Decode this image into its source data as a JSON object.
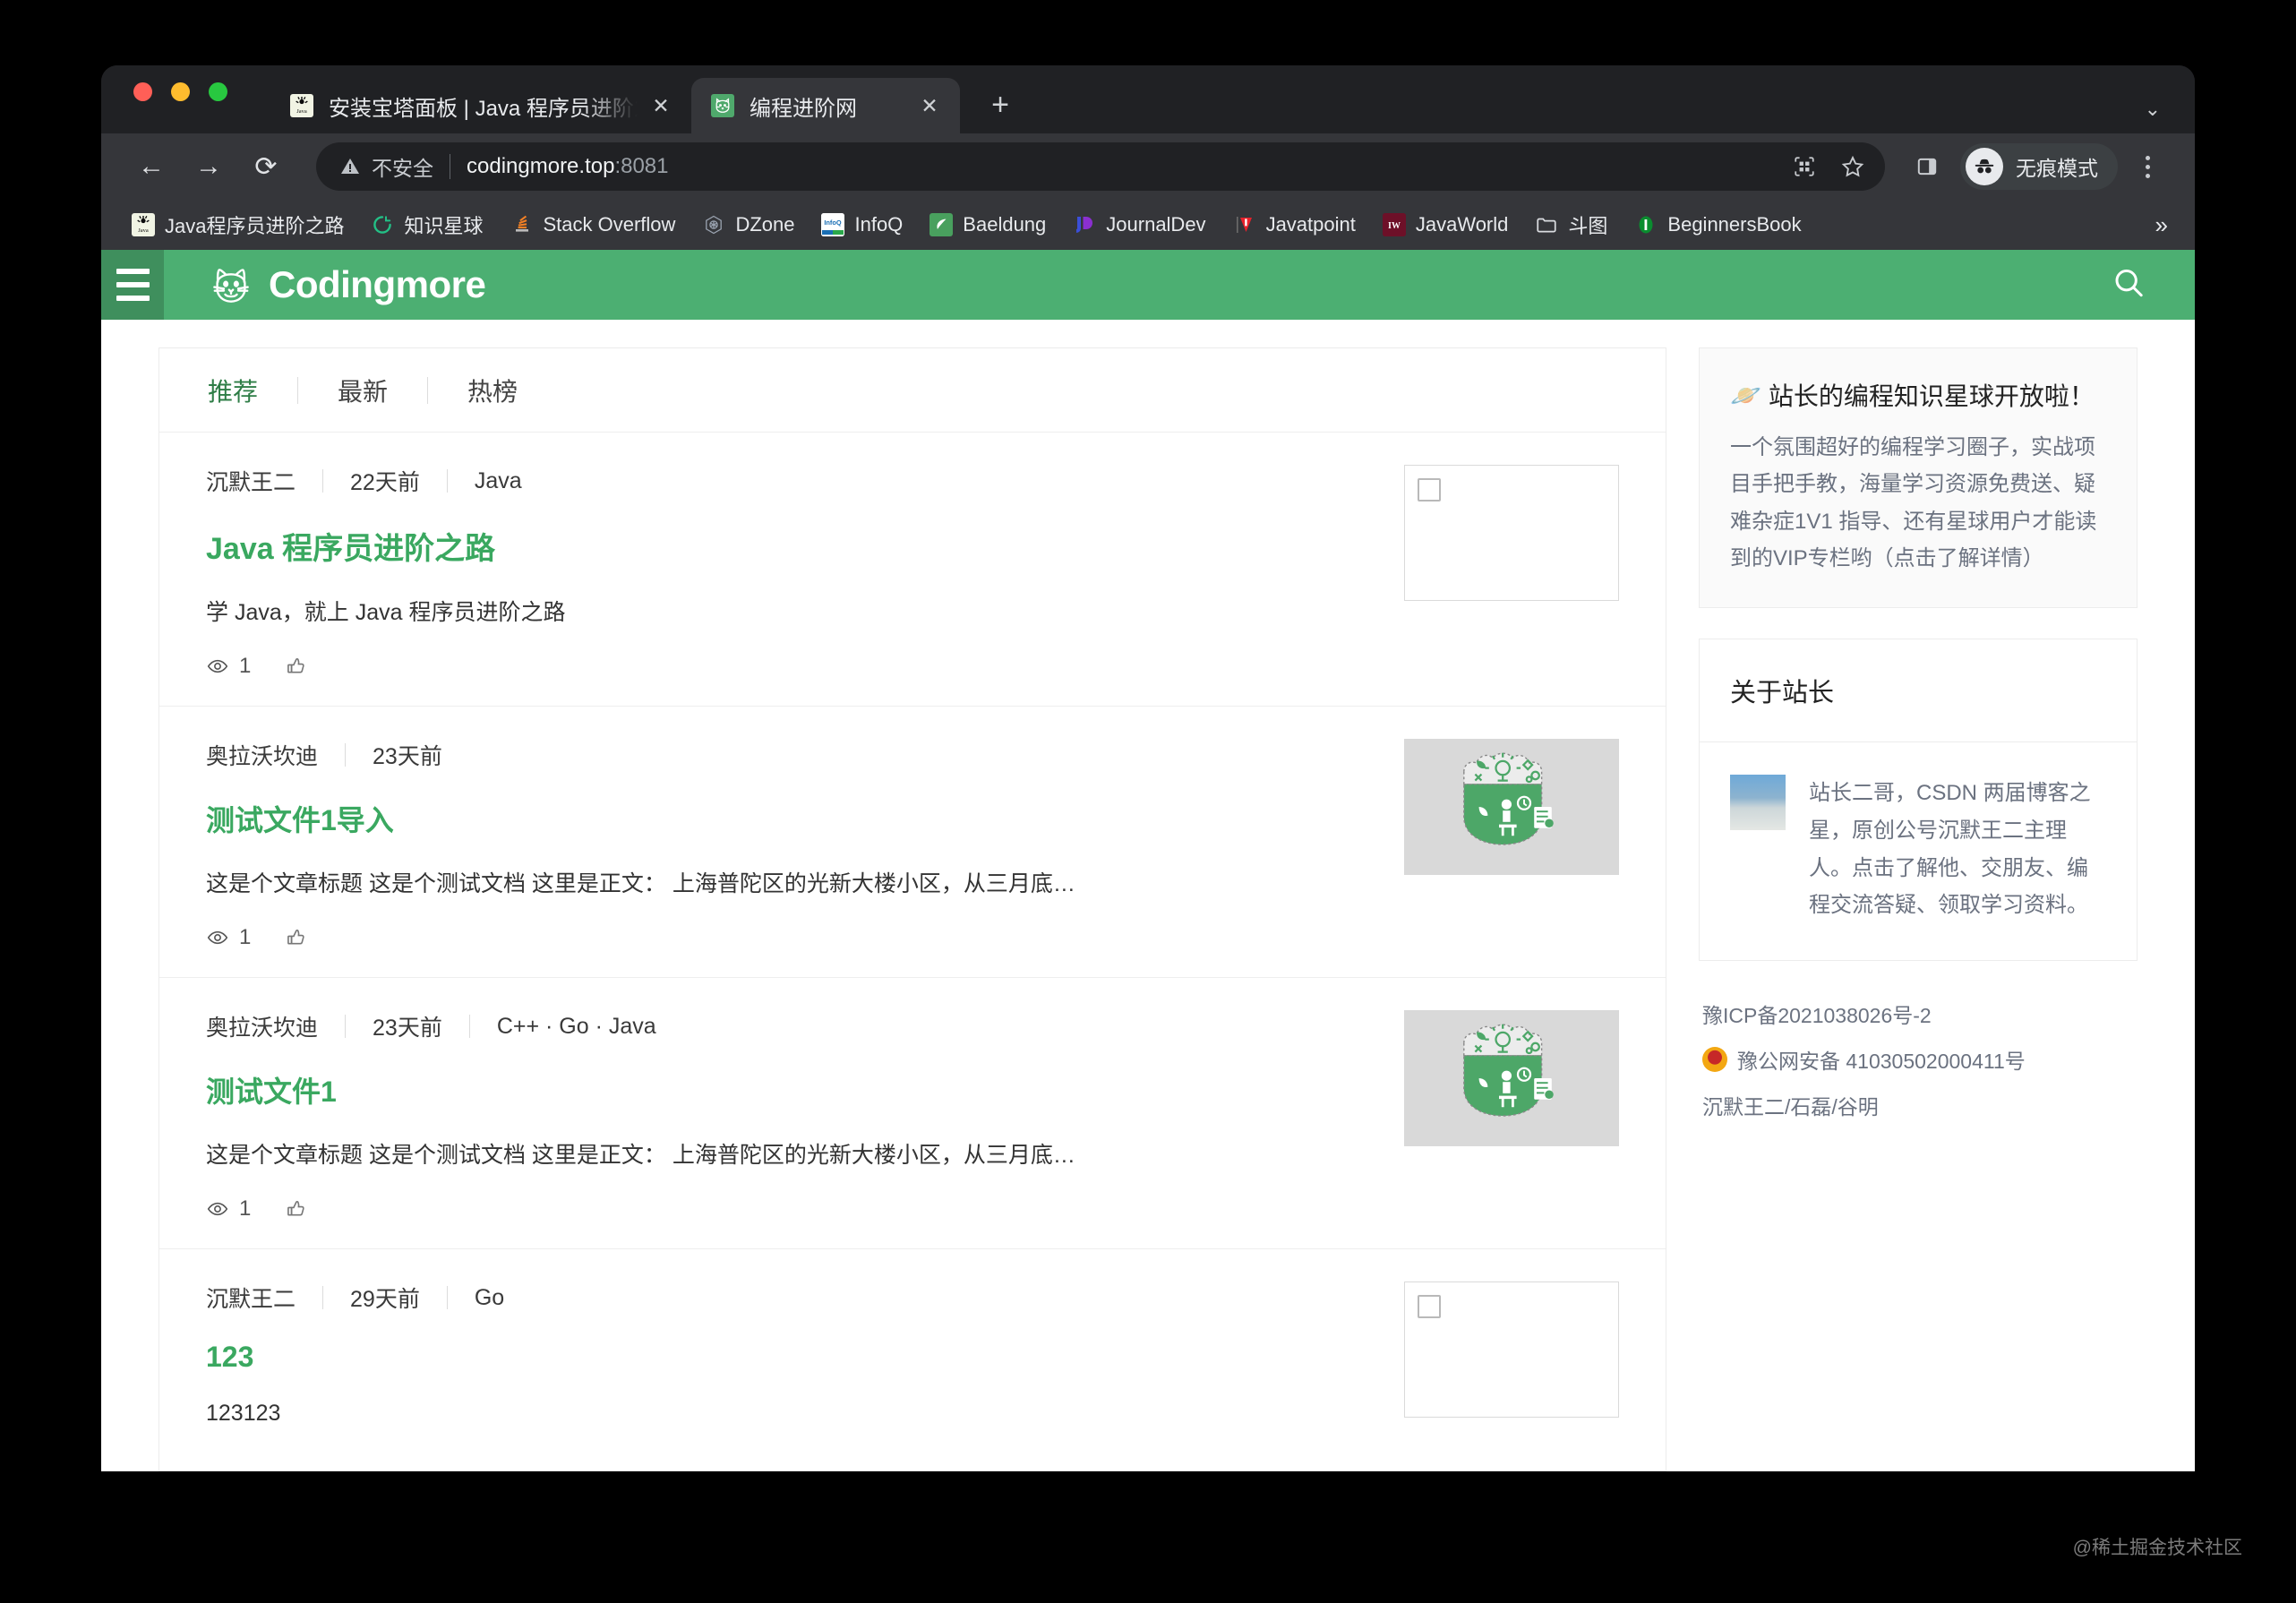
{
  "browser": {
    "tabs": [
      {
        "title": "安装宝塔面板 | Java 程序员进阶之路",
        "favicon": "java-icon",
        "active": false,
        "close_label": "✕"
      },
      {
        "title": "编程进阶网",
        "favicon": "cat-icon",
        "active": true,
        "close_label": "✕"
      }
    ],
    "new_tab_label": "+",
    "tabstrip_expand_label": "⌄",
    "toolbar": {
      "back_label": "←",
      "forward_label": "→",
      "reload_label": "⟳",
      "security_label": "不安全",
      "security_icon": "warning-triangle-icon",
      "url_host": "codingmore.top",
      "url_port": ":8081",
      "qr_icon": "qr-code-icon",
      "bookmark_icon": "star-icon",
      "sidepanel_icon": "side-panel-icon",
      "incognito_label": "无痕模式",
      "incognito_icon": "incognito-icon",
      "menu_icon": "kebab-menu-icon"
    },
    "bookmarks": [
      {
        "label": "Java程序员进阶之路",
        "icon": "java-favicon"
      },
      {
        "label": "知识星球",
        "icon": "zsxq-favicon"
      },
      {
        "label": "Stack Overflow",
        "icon": "stackoverflow-favicon"
      },
      {
        "label": "DZone",
        "icon": "dzone-favicon"
      },
      {
        "label": "InfoQ",
        "icon": "infoq-favicon"
      },
      {
        "label": "Baeldung",
        "icon": "baeldung-favicon"
      },
      {
        "label": "JournalDev",
        "icon": "journaldev-favicon"
      },
      {
        "label": "Javatpoint",
        "icon": "javatpoint-favicon"
      },
      {
        "label": "JavaWorld",
        "icon": "javaworld-favicon"
      },
      {
        "label": "斗图",
        "icon": "folder-icon"
      },
      {
        "label": "BeginnersBook",
        "icon": "beginnersbook-favicon"
      }
    ],
    "bookmarks_overflow_label": "»"
  },
  "site": {
    "brand": "Codingmore",
    "menu_icon": "hamburger-icon",
    "logo_icon": "cat-logo-icon",
    "search_icon": "search-icon",
    "accent_color": "#4caf72",
    "header_dark_color": "#3f8f5d",
    "link_color": "#3aa860"
  },
  "feed": {
    "tabs": [
      {
        "label": "推荐",
        "active": true
      },
      {
        "label": "最新",
        "active": false
      },
      {
        "label": "热榜",
        "active": false
      }
    ],
    "articles": [
      {
        "author": "沉默王二",
        "time": "22天前",
        "tags": "Java",
        "title": "Java 程序员进阶之路",
        "desc": "学 Java，就上 Java 程序员进阶之路",
        "views": "1",
        "view_icon": "eye-icon",
        "like_icon": "thumbs-up-icon",
        "thumb": "broken-image"
      },
      {
        "author": "奥拉沃坎迪",
        "time": "23天前",
        "tags": "",
        "title": "测试文件1导入",
        "desc": "这是个文章标题 这是个测试文档  这里是正文： 上海普陀区的光新大楼小区，从三月底…",
        "views": "1",
        "view_icon": "eye-icon",
        "like_icon": "thumbs-up-icon",
        "thumb": "badge-image"
      },
      {
        "author": "奥拉沃坎迪",
        "time": "23天前",
        "tags": "C++ · Go · Java",
        "title": "测试文件1",
        "desc": "这是个文章标题 这是个测试文档  这里是正文： 上海普陀区的光新大楼小区，从三月底…",
        "views": "1",
        "view_icon": "eye-icon",
        "like_icon": "thumbs-up-icon",
        "thumb": "badge-image"
      },
      {
        "author": "沉默王二",
        "time": "29天前",
        "tags": "Go",
        "title": "123",
        "desc": "123123",
        "views": "",
        "view_icon": "eye-icon",
        "like_icon": "thumbs-up-icon",
        "thumb": "broken-image"
      }
    ]
  },
  "sidebar": {
    "promo": {
      "emoji": "🪐",
      "title": "站长的编程知识星球开放啦！",
      "text": "一个氛围超好的编程学习圈子，实战项目手把手教，海量学习资源免费送、疑难杂症1V1 指导、还有星球用户才能读到的VIP专栏哟（点击了解详情）"
    },
    "about": {
      "heading": "关于站长",
      "text": "站长二哥，CSDN 两届博客之星，原创公号沉默王二主理人。点击了解他、交朋友、编程交流答疑、领取学习资料。",
      "avatar_icon": "author-avatar"
    },
    "footer": {
      "icp": "豫ICP备2021038026号-2",
      "police_icon": "police-badge-icon",
      "police": "豫公网安备 41030502000411号",
      "credits": "沉默王二/石磊/谷明"
    }
  },
  "watermark": "@稀土掘金技术社区"
}
